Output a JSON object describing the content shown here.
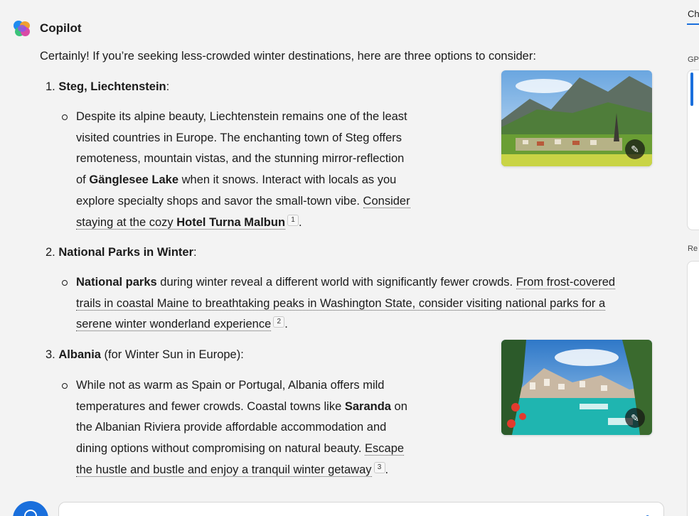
{
  "header": {
    "title": "Copilot"
  },
  "intro": "Certainly! If you’re seeking less-crowded winter destinations, here are three options to consider:",
  "items": [
    {
      "number": "1.",
      "title": "Steg, Liechtenstein",
      "suffix": ":",
      "lines": {
        "l1": "Despite its alpine beauty, Liechtenstein remains one of the least",
        "l2": "visited countries in Europe. The enchanting town of Steg offers",
        "l3": "remoteness, mountain vistas, and the stunning mirror-reflection",
        "l4_pre": "of ",
        "l4_bold": "Gänglesee Lake",
        "l4_post": " when it snows. Interact with locals as you",
        "l5_pre": "explore specialty shops and savor the small-town vibe. ",
        "l5_cite": "Consider",
        "l6_cite": "staying at the cozy ",
        "l6_bold": "Hotel Turna Malbun",
        "ref": "1",
        "end": "."
      }
    },
    {
      "number": "2.",
      "title": "National Parks in Winter",
      "suffix": ":",
      "lines": {
        "l1_bold": "National parks",
        "l1_post": " during winter reveal a different world with significantly fewer crowds. ",
        "l1_cite": "From frost-covered",
        "l2_cite": "trails in coastal Maine to breathtaking peaks in Washington State, consider visiting national parks for a",
        "l3_cite": "serene winter wonderland experience",
        "ref": "2",
        "end": "."
      }
    },
    {
      "number": "3.",
      "title": "Albania",
      "suffix": " (for Winter Sun in Europe):",
      "lines": {
        "l1": "While not as warm as Spain or Portugal, Albania offers mild",
        "l2_pre": "temperatures and fewer crowds. Coastal towns like ",
        "l2_bold": "Saranda",
        "l2_post": " on",
        "l3": "the Albanian Riviera provide affordable accommodation and",
        "l4_pre": "dining options without compromising on natural beauty. ",
        "l4_cite": "Escape",
        "l5_cite": "the hustle and bustle and enjoy a tranquil winter getaway",
        "ref": "3",
        "end": "."
      }
    }
  ],
  "right_panel": {
    "tab": "Ch",
    "gp": "GP",
    "re": "Re"
  },
  "colors": {
    "accent": "#1a6fdc",
    "background": "#f3f3f3"
  },
  "icons": {
    "edit": "magic-wand-icon",
    "logo": "copilot-logo-icon",
    "compose": "new-topic-icon",
    "mic": "microphone-icon"
  }
}
